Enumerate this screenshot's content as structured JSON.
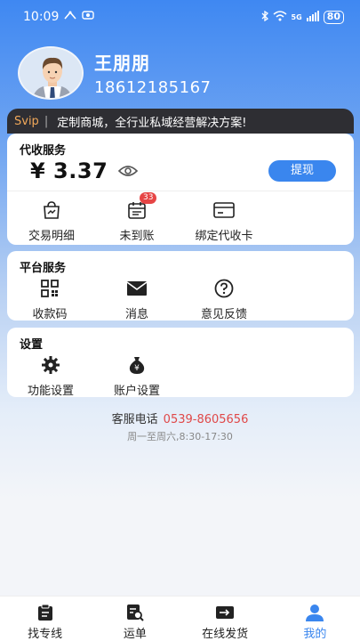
{
  "status": {
    "time": "10:09",
    "battery": "80",
    "network": "5G"
  },
  "user": {
    "name": "王朋朋",
    "phone": "18612185167"
  },
  "svip": {
    "tag": "Svip",
    "text": "定制商城，全行业私域经营解决方案!"
  },
  "collection": {
    "title": "代收服务",
    "balance": "¥ 3.37",
    "withdraw_label": "提现",
    "items": [
      {
        "label": "交易明细"
      },
      {
        "label": "未到账",
        "badge": "33"
      },
      {
        "label": "绑定代收卡"
      }
    ]
  },
  "platform": {
    "title": "平台服务",
    "items": [
      {
        "label": "收款码"
      },
      {
        "label": "消息"
      },
      {
        "label": "意见反馈"
      }
    ]
  },
  "settings": {
    "title": "设置",
    "items": [
      {
        "label": "功能设置"
      },
      {
        "label": "账户设置"
      }
    ]
  },
  "service": {
    "label": "客服电话",
    "phone": "0539-8605656",
    "hours": "周一至周六,8:30-17:30"
  },
  "tabs": [
    {
      "label": "找专线"
    },
    {
      "label": "运单"
    },
    {
      "label": "在线发货"
    },
    {
      "label": "我的"
    }
  ],
  "colors": {
    "accent": "#3a86ee",
    "badge": "#e64545",
    "phone": "#e04848",
    "svip": "#f0a85a"
  }
}
